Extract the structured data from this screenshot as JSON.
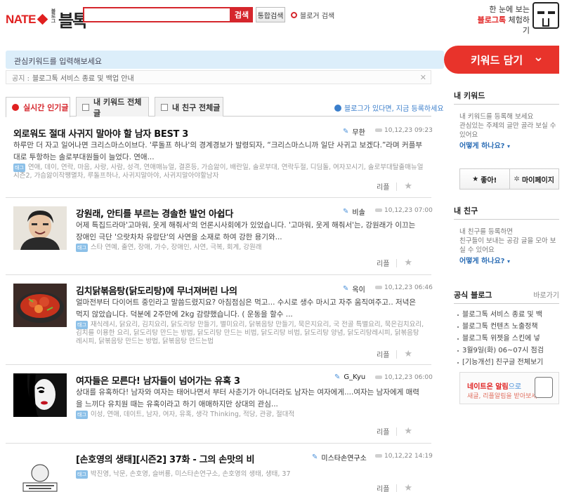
{
  "header": {
    "logo_nate": "NATE",
    "logo_small": "블로그",
    "logo_name": "블톡",
    "search_button": "검색",
    "total_search": "통합검색",
    "blogger_search": "블로거 검색",
    "promo_line1": "한 눈에 보는",
    "promo_line2_red": "블로그톡",
    "promo_line2_rest": " 체험하기"
  },
  "keyword": {
    "placeholder": "관심키워드를 입력해보세요",
    "button": "키워드 담기",
    "notice_label": "공지 :",
    "notice_text": "블로그톡 서비스 종료 및 백업 안내"
  },
  "tabs": [
    {
      "label": "실시간 인기글"
    },
    {
      "label": "내 키워드 전체글"
    },
    {
      "label": "내 친구 전체글"
    }
  ],
  "register_link": "블로그가 있다면, 지금 등록하세요",
  "posts": [
    {
      "title": "외로워도 절대 사귀지 말아야 할 남자 BEST 3",
      "author": "무한",
      "date": "10,12,23 09:23",
      "summary": "하루만 더 자고 일어나면 크리스마스이브다. '루돌프 하나'의 경계경보가 발령되자, “크리스마스니까 일단 사귀고 보겠다.”라며 커플부대로 투항하는 솔로부대원들이 늘었다. 연애...",
      "tags": "연애, 데이, 연락, 마음, 사랑, 사람, 성격, 연애매뉴얼, 결혼등, 가슴앓이, 배란일, 솔로부대, 연락두절, 디딤돌, 여자꼬시기, 솔로부대탈출매뉴얼 시즌2, 가슴앓이작쨍멸차, 루돌프하나, 사귀지말아야, 사귀지말아야할남자",
      "reply": "리플"
    },
    {
      "title": "강원래, 안티를 부르는 경솔한 발언 아쉽다",
      "author": "비솔",
      "date": "10,12,23 07:00",
      "summary": "어제 특집드라마'고마워, 웃게 해줘서'의 언론시사회에가 있었습니다. '고마워, 웃게 해줘서'는, 강원래가 이끄는 장애인 극단 '으랏차차 유랑단'의 사연을 소재로 하여 강한 용기와...",
      "tags": "스타 연예, 출연, 장애, 가수, 장애인, 사연, 극복, 회계, 강원래",
      "reply": "리플"
    },
    {
      "title": "김치닭볶음탕(닭도리탕)에 무너져버린 나의",
      "author": "옥이",
      "date": "10,12,23 06:46",
      "summary": "얼마전부터 다이어트 중인라고 말씀드렸지요? 아침점심은 먹고... 수시로 생수 마시고 자주 움직여주고.. 저녁은 먹지 않았습니다. 덕분에 2주만에 2kg 감량했습니다. ( 운동을 할수 ...",
      "tags": "재식레시, 닭요리, 김치요리, 닭도리탕 만들기, 별미요리, 닭볶음탕 만들기, 묵은지요리, 국 전골 특별요리, 묵은김치요리, 김치를 이용한 요리, 닭도리탕 만드는 방법, 닭도리탕 만드는 비법, 닭도리탕 비법, 닭도리탕 양념, 닭도리탕레시피, 닭볶음탕 레시피, 닭볶음탕 만드는 방법, 닭볶음탕 만드는법",
      "reply": "리플"
    },
    {
      "title": "여자들은 모른다! 남자들이 넘어가는 유혹 3",
      "author": "G_Kyu",
      "date": "10,12,23 06:00",
      "summary": "상대를 유혹하다! 남자와 여자는 태어나면서 부터 사춘기가 아니더라도 남자는 여자에게....여자는 남자에게 매력을 느끼다 유치원 때는 유혹이라고 하기 애매하지만 상대의 관심...",
      "tags": "이성, 연애, 데이트, 남자, 여자, 유혹, 생각 Thinking, 적당, 관광, 절대적",
      "reply": "리플"
    },
    {
      "title": "[손호영의 생태][시즌2] 37화 - 그의 손맛의 비",
      "author": "미스타손연구소",
      "date": "10,12,22 14:19",
      "summary": "",
      "tags": "박진영, 낙문, 손호영, 슬버룡, 미스타손연구소, 손호영의 생태, 생태, 37",
      "reply": "리플"
    }
  ],
  "sidebar": {
    "my_keyword_title": "내 키워드",
    "my_keyword_desc": "내 키워드를 등록해 보세요\n관심있는 주제의 글만 골라 보실 수 있어요",
    "how_link": "어떻게 하나요?",
    "like": "좋아!",
    "mypage": "마이페이지",
    "my_friend_title": "내 친구",
    "my_friend_desc": "내 친구를 등록하면\n친구들이 보내는 공감 글을 모아 보실 수 있어요",
    "official_title": "공식 블로그",
    "official_more": "바로가기",
    "official_items": [
      "블로그톡 서비스 종료 및 백",
      "블로그톡 컨텐츠 노출정책",
      "블로그톡 위젯을 스킨에 넣",
      "3월9일(화) 06~07시 점검",
      "[기능개선] 친구글 전체보기"
    ],
    "alarm_title": "네이트온 알림",
    "alarm_suffix": "으로",
    "alarm_desc": "새글, 리플알림을 받아보세요"
  }
}
